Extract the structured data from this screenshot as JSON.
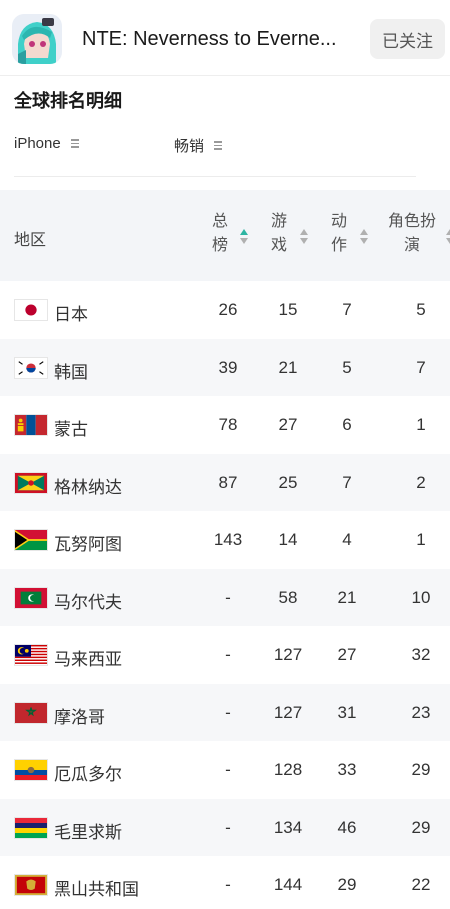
{
  "app": {
    "title": "NTE: Neverness to Everne...",
    "follow_label": "已关注"
  },
  "section": {
    "title": "全球排名明细"
  },
  "filters": [
    {
      "label": "iPhone"
    },
    {
      "label": "畅销"
    }
  ],
  "table": {
    "headers": {
      "region": "地区",
      "col1_a": "总",
      "col1_b": "榜",
      "col2_a": "游",
      "col2_b": "戏",
      "col3_a": "动",
      "col3_b": "作",
      "col4_a": "角色扮",
      "col4_b": "演"
    },
    "rows": [
      {
        "country": "日本",
        "flag": "japan",
        "c1": "26",
        "c2": "15",
        "c3": "7",
        "c4": "5"
      },
      {
        "country": "韩国",
        "flag": "korea",
        "c1": "39",
        "c2": "21",
        "c3": "5",
        "c4": "7"
      },
      {
        "country": "蒙古",
        "flag": "mongolia",
        "c1": "78",
        "c2": "27",
        "c3": "6",
        "c4": "1"
      },
      {
        "country": "格林纳达",
        "flag": "grenada",
        "c1": "87",
        "c2": "25",
        "c3": "7",
        "c4": "2"
      },
      {
        "country": "瓦努阿图",
        "flag": "vanuatu",
        "c1": "143",
        "c2": "14",
        "c3": "4",
        "c4": "1"
      },
      {
        "country": "马尔代夫",
        "flag": "maldives",
        "c1": "-",
        "c2": "58",
        "c3": "21",
        "c4": "10"
      },
      {
        "country": "马来西亚",
        "flag": "malaysia",
        "c1": "-",
        "c2": "127",
        "c3": "27",
        "c4": "32"
      },
      {
        "country": "摩洛哥",
        "flag": "morocco",
        "c1": "-",
        "c2": "127",
        "c3": "31",
        "c4": "23"
      },
      {
        "country": "厄瓜多尔",
        "flag": "ecuador",
        "c1": "-",
        "c2": "128",
        "c3": "33",
        "c4": "29"
      },
      {
        "country": "毛里求斯",
        "flag": "mauritius",
        "c1": "-",
        "c2": "134",
        "c3": "46",
        "c4": "29"
      },
      {
        "country": "黑山共和国",
        "flag": "montenegro",
        "c1": "-",
        "c2": "144",
        "c3": "29",
        "c4": "22"
      }
    ]
  },
  "colors": {
    "accent_sort": "#2db5a3",
    "header_bg": "#f3f5f8",
    "row_alt_bg": "#f6f7f9"
  }
}
